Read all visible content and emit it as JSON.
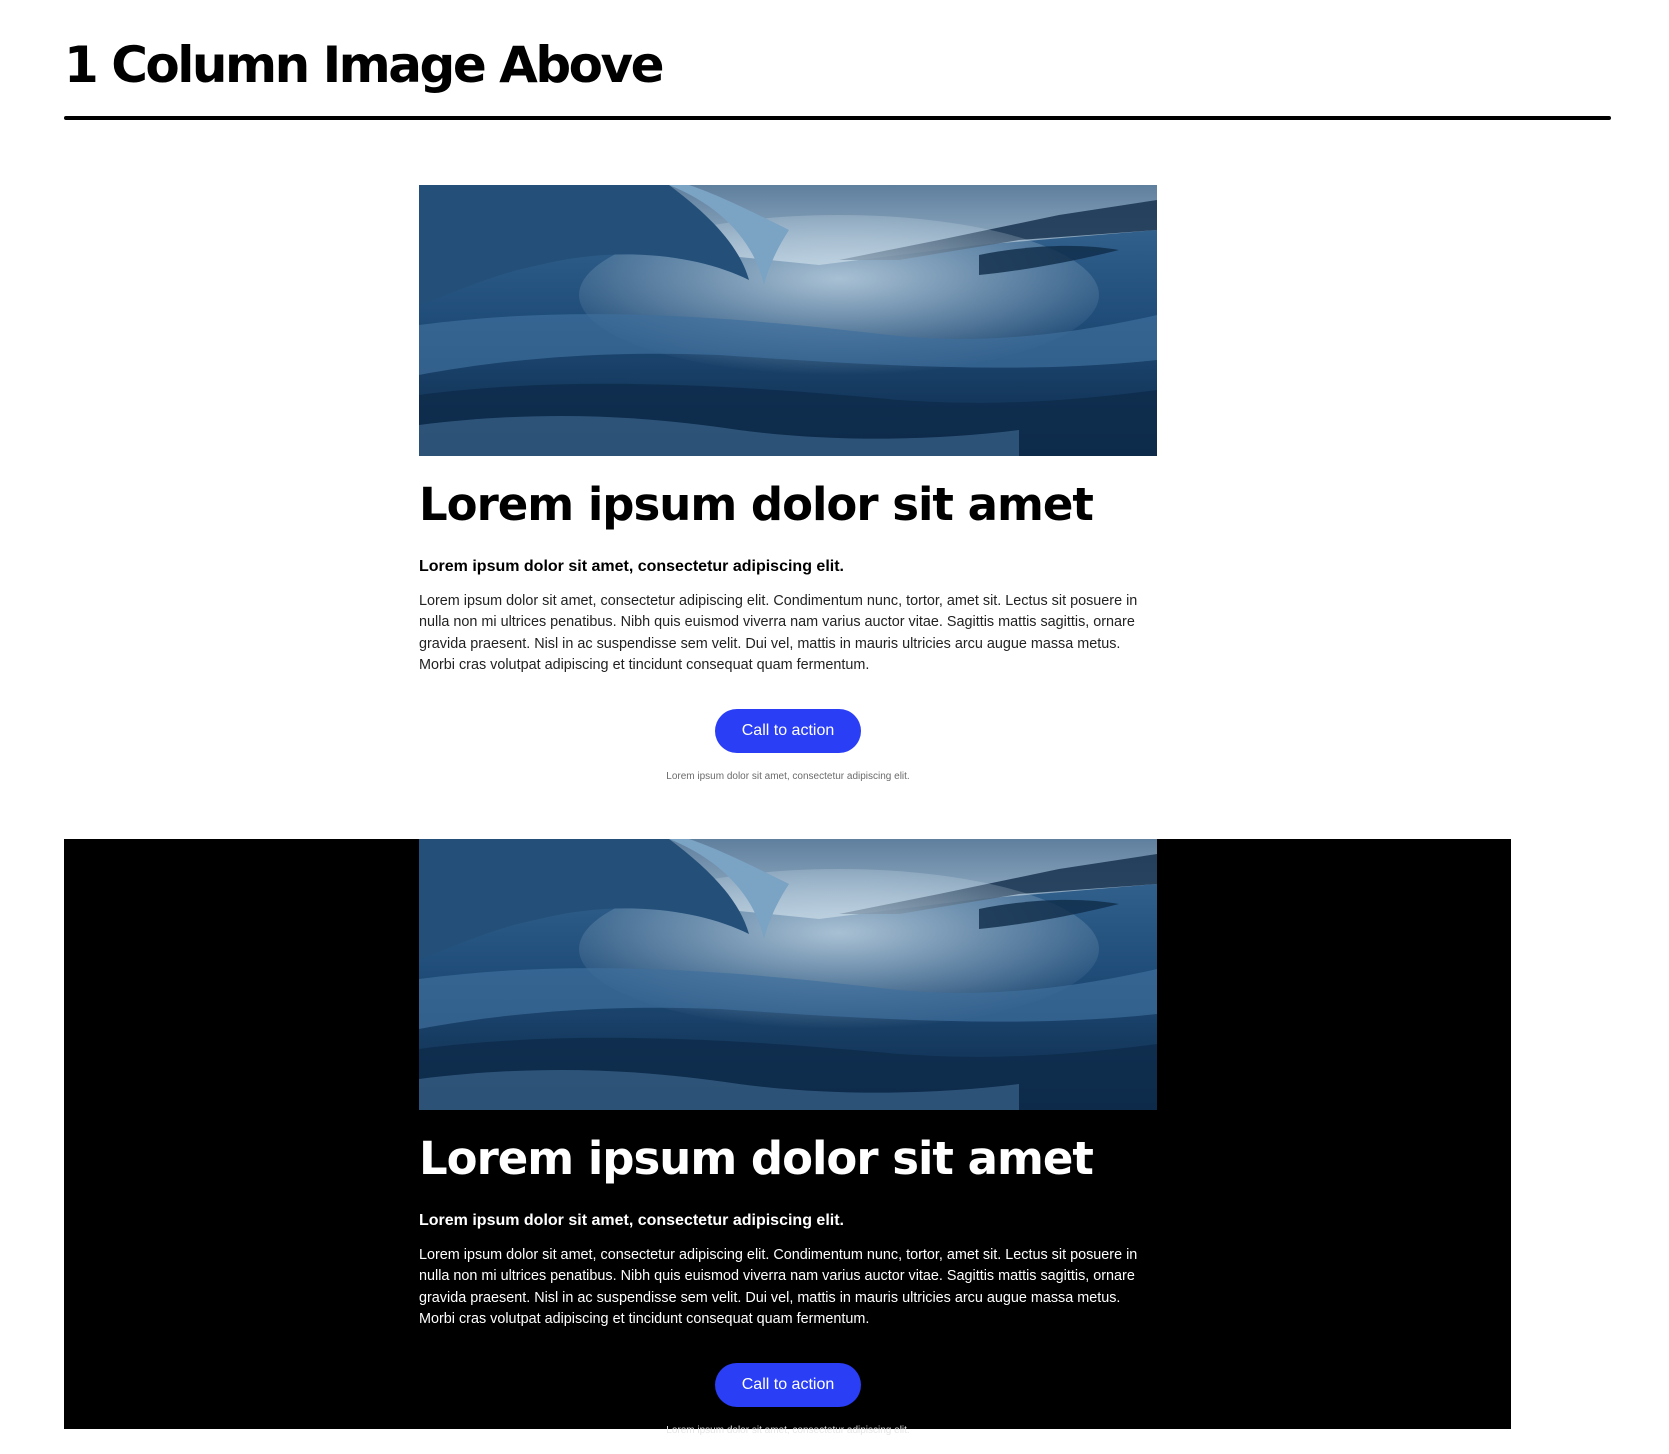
{
  "page": {
    "title": "1 Column Image Above"
  },
  "colors": {
    "accent": "#2a3ef5",
    "dark_section_bg": "#000000",
    "light_section_bg": "#ffffff"
  },
  "sections": [
    {
      "theme": "light",
      "image_alt_icon": "ocean-wave-image",
      "heading": "Lorem ipsum dolor sit amet",
      "subheading": "Lorem ipsum dolor sit amet, consectetur adipiscing elit.",
      "body": "Lorem ipsum dolor sit amet, consectetur adipiscing elit. Condimentum nunc, tortor, amet sit. Lectus sit posuere in nulla non mi ultrices penatibus. Nibh quis euismod viverra nam varius auctor vitae. Sagittis mattis sagittis, ornare gravida praesent. Nisl in ac suspendisse sem velit. Dui vel, mattis in mauris ultricies arcu augue massa metus. Morbi cras volutpat adipiscing et tincidunt consequat quam fermentum.",
      "cta_label": "Call to action",
      "fine_print": "Lorem ipsum dolor sit amet, consectetur adipiscing elit."
    },
    {
      "theme": "dark",
      "image_alt_icon": "ocean-wave-image",
      "heading": "Lorem ipsum dolor sit amet",
      "subheading": "Lorem ipsum dolor sit amet, consectetur adipiscing elit.",
      "body": "Lorem ipsum dolor sit amet, consectetur adipiscing elit. Condimentum nunc, tortor, amet sit. Lectus sit posuere in nulla non mi ultrices penatibus. Nibh quis euismod viverra nam varius auctor vitae. Sagittis mattis sagittis, ornare gravida praesent. Nisl in ac suspendisse sem velit. Dui vel, mattis in mauris ultricies arcu augue massa metus. Morbi cras volutpat adipiscing et tincidunt consequat quam fermentum.",
      "cta_label": "Call to action",
      "fine_print": "Lorem ipsum dolor sit amet, consectetur adipiscing elit."
    }
  ]
}
